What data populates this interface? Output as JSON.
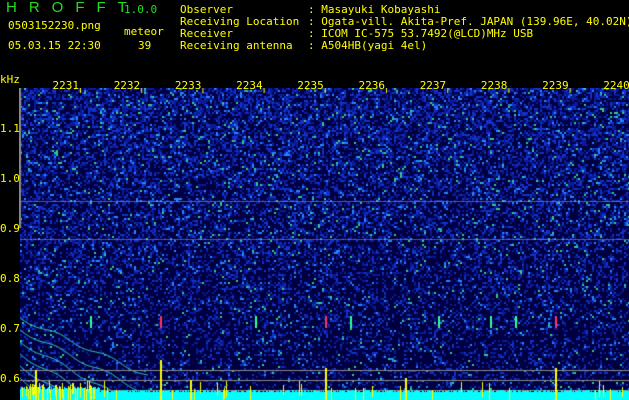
{
  "header": {
    "title": "HROFFT",
    "version": "1.0.0",
    "filename": "0503152230.png",
    "meteor_label": "meteor",
    "datetime": "05.03.15 22:30",
    "meteor_count": "39"
  },
  "info": [
    {
      "label": "Observer",
      "value": "Masayuki Kobayashi"
    },
    {
      "label": "Receiving Location",
      "value": "Ogata-vill. Akita-Pref. JAPAN (139.96E, 40.02N)"
    },
    {
      "label": "Receiver",
      "value": "ICOM IC-575 53.7492(@LCD)MHz USB"
    },
    {
      "label": "Receiving antenna",
      "value": "A504HB(yagi 4el)"
    }
  ],
  "axis": {
    "unit": "kHz",
    "y_ticks": [
      "1.1",
      "1.0",
      "0.9",
      "0.8",
      "0.7",
      "0.6"
    ],
    "x_ticks": [
      "2231",
      "2232",
      "2233",
      "2234",
      "2235",
      "2236",
      "2237",
      "2238",
      "2239",
      "2240"
    ]
  },
  "colors": {
    "text": "#ffff00",
    "title": "#22dd22",
    "bg": "#000000",
    "signal": "#00ffff"
  }
}
